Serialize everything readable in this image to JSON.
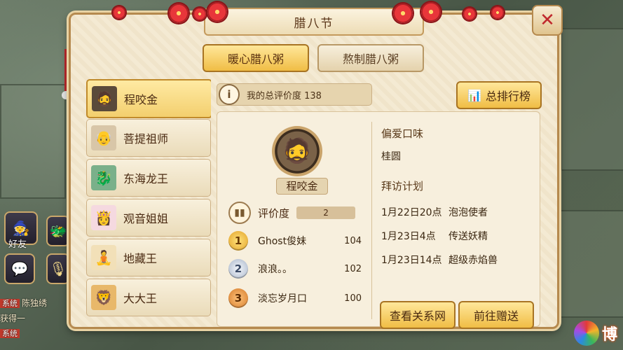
{
  "dialog": {
    "title": "腊八节",
    "close_icon": "✕"
  },
  "tabs": [
    {
      "label": "暖心腊八粥",
      "active": true
    },
    {
      "label": "熬制腊八粥",
      "active": false
    }
  ],
  "characters": [
    {
      "name": "程咬金",
      "icon": "🧔",
      "active": true
    },
    {
      "name": "菩提祖师",
      "icon": "👴",
      "active": false
    },
    {
      "name": "东海龙王",
      "icon": "🐉",
      "active": false
    },
    {
      "name": "观音姐姐",
      "icon": "👸",
      "active": false
    },
    {
      "name": "地藏王",
      "icon": "🧘",
      "active": false
    },
    {
      "name": "大大王",
      "icon": "🦁",
      "active": false
    }
  ],
  "info": {
    "icon": "i",
    "text": "我的总评价度 138"
  },
  "rank_button": {
    "label": "总排行榜",
    "icon": "📊"
  },
  "profile": {
    "name": "程咬金",
    "portrait_icon": "🧔",
    "rating_label": "评价度",
    "rating_value": "2"
  },
  "ranking": [
    {
      "rank": "1",
      "name": "Ghost俊妹",
      "score": "104",
      "medal": "gold"
    },
    {
      "rank": "2",
      "name": "浪浪。。",
      "score": "102",
      "medal": "silver"
    },
    {
      "rank": "3",
      "name": "淡忘岁月口",
      "score": "100",
      "medal": "bronze"
    }
  ],
  "preference": {
    "title": "偏爱口味",
    "value": "桂圆"
  },
  "visit_plan": {
    "title": "拜访计划",
    "items": [
      {
        "date": "1月22日20点",
        "event": "泡泡使者"
      },
      {
        "date": "1月23日4点",
        "event": "传送妖精"
      },
      {
        "date": "1月23日14点",
        "event": "超级赤焰兽"
      }
    ]
  },
  "actions": {
    "view_relations": "查看关系网",
    "go_gift": "前往赠送"
  },
  "hud": {
    "friend_label": "好友",
    "chat_lines": [
      {
        "tag": "系统",
        "text": "陈独绣"
      },
      {
        "tag": "",
        "text": "获得一"
      },
      {
        "tag": "系统",
        "text": ""
      }
    ]
  },
  "watermark": {
    "text": "博"
  },
  "colors": {
    "accent_gold": "#f0bd45",
    "frame_brown": "#b5894e",
    "parchment": "#f4ead3",
    "close_red": "#c0282d"
  }
}
